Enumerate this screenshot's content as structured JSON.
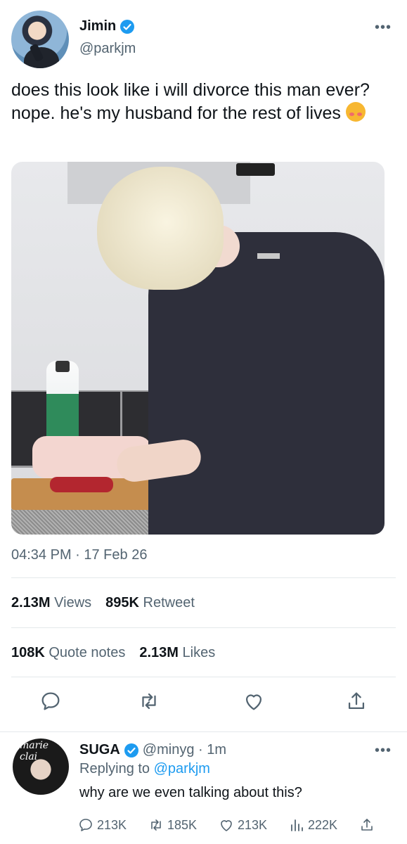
{
  "tweet": {
    "display_name": "Jimin",
    "handle": "@parkjm",
    "more_label": "•••",
    "text": "does this look like i will divorce this man ever? nope. he's my husband for the rest of lives",
    "emoji": "smiling-face-with-hearts",
    "timestamp": "04:34 PM · 17 Feb 26",
    "stats": {
      "views_count": "2.13M",
      "views_label": "Views",
      "retweets_count": "895K",
      "retweets_label": "Retweet",
      "quotes_count": "108K",
      "quotes_label": "Quote notes",
      "likes_count": "2.13M",
      "likes_label": "Likes"
    }
  },
  "reply": {
    "display_name": "SUGA",
    "handle_time": "@minyg · 1m",
    "replying_prefix": "Replying to",
    "replying_handle": "@parkjm",
    "text": "why are we even talking about this?",
    "avatar_brand": "marie clai",
    "more_label": "•••",
    "counts": {
      "replies": "213K",
      "retweets": "185K",
      "likes": "213K",
      "views": "222K"
    }
  },
  "colors": {
    "accent": "#1d9bf0",
    "text": "#0f1419",
    "muted": "#536471"
  }
}
